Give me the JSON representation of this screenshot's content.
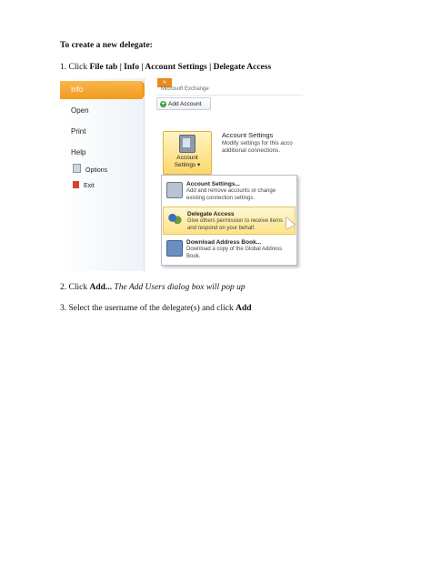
{
  "heading": "To create a new delegate:",
  "step1": {
    "prefix": "1. Click ",
    "bold": "File tab | Info | Account Settings |  Delegate Access"
  },
  "step2": {
    "prefix": "2. Click ",
    "bold": "Add...",
    "italic": " The Add Users dialog box will pop up"
  },
  "step3": {
    "text": "3. Select the username of the delegate(s) and click ",
    "bold": "Add"
  },
  "screenshot": {
    "sidebar": {
      "items": [
        "Info",
        "Open",
        "Print",
        "Help"
      ],
      "options": "Options",
      "exit": "Exit"
    },
    "exchange_label": "Microsoft Exchange",
    "add_account": "Add Account",
    "account_settings_button": [
      "Account",
      "Settings"
    ],
    "account_settings_title": "Account Settings",
    "account_settings_desc": "Modify settings for this acco additional connections.",
    "menu": [
      {
        "title": "Account Settings...",
        "desc": "Add and remove accounts or change existing connection settings."
      },
      {
        "title": "Delegate Access",
        "desc": "Give others permission to receive items and respond on your behalf."
      },
      {
        "title": "Download Address Book...",
        "desc": "Download a copy of the Global Address Book."
      }
    ],
    "colors": {
      "accent_orange": "#f29a1f",
      "highlight": "#fde388"
    }
  }
}
